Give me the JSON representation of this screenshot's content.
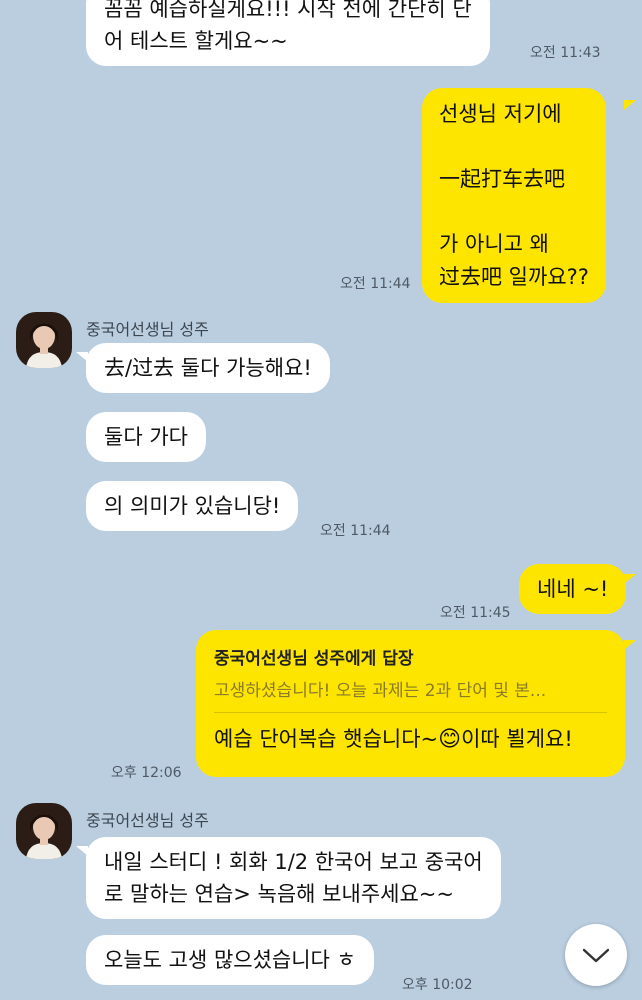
{
  "colors": {
    "background": "#bacee0",
    "my_bubble": "#fee500",
    "other_bubble": "#ffffff"
  },
  "messages": {
    "m0": {
      "text": "꼼꼼 예습하실게요!!! 시작 전에 간단히 단\n어 테스트 할게요~~",
      "time": "오전 11:43"
    },
    "m1": {
      "text": "선생님 저기에\n\n一起打车去吧\n\n가 아니고 왜\n过去吧 일까요??",
      "time": "오전 11:44"
    },
    "sender1": {
      "name": "중국어선생님 성주"
    },
    "m2": {
      "text": "去/过去 둘다 가능해요!"
    },
    "m3": {
      "text": "둘다 가다"
    },
    "m4": {
      "text": "의 의미가 있습니당!",
      "time": "오전 11:44"
    },
    "m5": {
      "text": "네네 ~!",
      "time": "오전 11:45"
    },
    "m6": {
      "reply_to": "중국어선생님 성주에게 답장",
      "quoted": "고생하셨습니다! 오늘 과제는 2과 단어 및 본...",
      "text_before": "예습 단어복습 햇습니다~",
      "emoji": "😊",
      "text_after": "이따 뵐게요!",
      "time": "오후 12:06"
    },
    "sender2": {
      "name": "중국어선생님 성주"
    },
    "m7": {
      "text": "내일 스터디 ! 회화 1/2 한국어 보고 중국어\n로 말하는 연습> 녹음해 보내주세요~~"
    },
    "m8": {
      "text": "오늘도 고생 많으셨습니다 ㅎ",
      "time": "오후 10:02"
    }
  },
  "icons": {
    "scroll_down": "chevron-down-icon",
    "avatar": "profile-photo"
  }
}
